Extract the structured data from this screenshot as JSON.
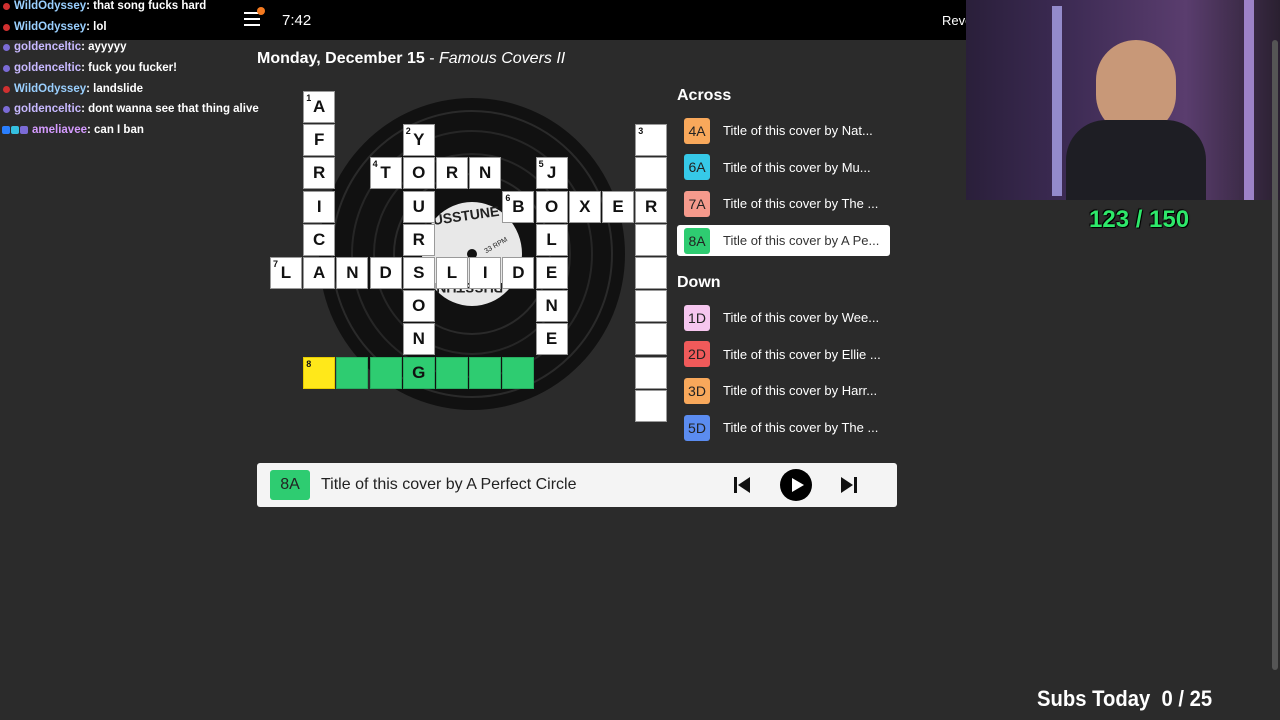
{
  "topbar": {
    "timer": "7:42",
    "reveal_label": "Reve"
  },
  "chat": [
    {
      "user": "WildOdyssey",
      "msg": " : that song fucks hard",
      "badge": "red"
    },
    {
      "user": "WildOdyssey",
      "msg": " : lol",
      "badge": "red"
    },
    {
      "user": "goldenceltic",
      "msg": " : ayyyyy",
      "badge": "purple"
    },
    {
      "user": "goldenceltic",
      "msg": " : fuck you fucker!",
      "badge": "purple"
    },
    {
      "user": "WildOdyssey",
      "msg": " : landslide",
      "badge": "red"
    },
    {
      "user": "goldenceltic",
      "msg": " : dont wanna see that thing alive",
      "badge": "purple"
    },
    {
      "user": "ameliavee",
      "msg": " : can I ban",
      "badge": "multi"
    }
  ],
  "puzzle": {
    "date": "Monday, December 15",
    "separator": " - ",
    "theme": "Famous Covers II"
  },
  "record_label": {
    "top": "PUSSTUNE",
    "rpm": "33 RPM",
    "bottom": "PUSSTUNE"
  },
  "grid": {
    "cells": [
      {
        "r": 0,
        "c": 1,
        "l": "A",
        "n": "1"
      },
      {
        "r": 1,
        "c": 1,
        "l": "F"
      },
      {
        "r": 2,
        "c": 1,
        "l": "R"
      },
      {
        "r": 3,
        "c": 1,
        "l": "I"
      },
      {
        "r": 4,
        "c": 1,
        "l": "C"
      },
      {
        "r": 5,
        "c": 1,
        "l": "A"
      },
      {
        "r": 1,
        "c": 4,
        "l": "Y",
        "n": "2"
      },
      {
        "r": 2,
        "c": 4,
        "l": "O"
      },
      {
        "r": 3,
        "c": 4,
        "l": "U"
      },
      {
        "r": 4,
        "c": 4,
        "l": "R"
      },
      {
        "r": 5,
        "c": 4,
        "l": "S"
      },
      {
        "r": 6,
        "c": 4,
        "l": "O"
      },
      {
        "r": 7,
        "c": 4,
        "l": "N"
      },
      {
        "r": 2,
        "c": 3,
        "l": "T",
        "n": "4"
      },
      {
        "r": 2,
        "c": 5,
        "l": "R"
      },
      {
        "r": 2,
        "c": 6,
        "l": "N"
      },
      {
        "r": 2,
        "c": 8,
        "l": "J",
        "n": "5"
      },
      {
        "r": 3,
        "c": 8,
        "l": "O"
      },
      {
        "r": 4,
        "c": 8,
        "l": "L"
      },
      {
        "r": 5,
        "c": 8,
        "l": "E"
      },
      {
        "r": 6,
        "c": 8,
        "l": "N"
      },
      {
        "r": 7,
        "c": 8,
        "l": "E"
      },
      {
        "r": 3,
        "c": 7,
        "l": "B",
        "n": "6"
      },
      {
        "r": 3,
        "c": 9,
        "l": "X"
      },
      {
        "r": 3,
        "c": 10,
        "l": "E"
      },
      {
        "r": 3,
        "c": 11,
        "l": "R"
      },
      {
        "r": 5,
        "c": 0,
        "l": "L",
        "n": "7"
      },
      {
        "r": 5,
        "c": 2,
        "l": "N"
      },
      {
        "r": 5,
        "c": 3,
        "l": "D"
      },
      {
        "r": 5,
        "c": 5,
        "l": "L"
      },
      {
        "r": 5,
        "c": 6,
        "l": "I"
      },
      {
        "r": 5,
        "c": 7,
        "l": "D"
      },
      {
        "r": 1,
        "c": 11,
        "l": "",
        "n": "3"
      },
      {
        "r": 2,
        "c": 11,
        "l": ""
      },
      {
        "r": 4,
        "c": 11,
        "l": ""
      },
      {
        "r": 5,
        "c": 11,
        "l": ""
      },
      {
        "r": 6,
        "c": 11,
        "l": ""
      },
      {
        "r": 7,
        "c": 11,
        "l": ""
      },
      {
        "r": 8,
        "c": 11,
        "l": ""
      },
      {
        "r": 9,
        "c": 11,
        "l": ""
      },
      {
        "r": 8,
        "c": 1,
        "l": "",
        "n": "8",
        "state": "yellow"
      },
      {
        "r": 8,
        "c": 2,
        "l": "",
        "state": "green"
      },
      {
        "r": 8,
        "c": 3,
        "l": "",
        "state": "green"
      },
      {
        "r": 8,
        "c": 4,
        "l": "G",
        "state": "green"
      },
      {
        "r": 8,
        "c": 5,
        "l": "",
        "state": "green"
      },
      {
        "r": 8,
        "c": 6,
        "l": "",
        "state": "green"
      },
      {
        "r": 8,
        "c": 7,
        "l": "",
        "state": "green"
      }
    ]
  },
  "across_heading": "Across",
  "down_heading": "Down",
  "across": [
    {
      "id": "4A",
      "text": "Title of this cover by Nat...",
      "color": "#f8a85b"
    },
    {
      "id": "6A",
      "text": "Title of this cover by Mu...",
      "color": "#36c9e8"
    },
    {
      "id": "7A",
      "text": "Title of this cover by The ...",
      "color": "#f59a8c"
    },
    {
      "id": "8A",
      "text": "Title of this cover by A Pe...",
      "color": "#2ecc71",
      "active": true
    }
  ],
  "down": [
    {
      "id": "1D",
      "text": "Title of this cover by Wee...",
      "color": "#f6c6ef"
    },
    {
      "id": "2D",
      "text": "Title of this cover by Ellie ...",
      "color": "#f05a5a"
    },
    {
      "id": "3D",
      "text": "Title of this cover by Harr...",
      "color": "#f8a85b"
    },
    {
      "id": "5D",
      "text": "Title of this cover by The ...",
      "color": "#5b8cf0"
    }
  ],
  "clue_bar": {
    "id": "8A",
    "text": "Title of this cover by A Perfect Circle"
  },
  "overlay": {
    "score": "123 / 150",
    "subs": "Subs Today  0 / 25"
  }
}
